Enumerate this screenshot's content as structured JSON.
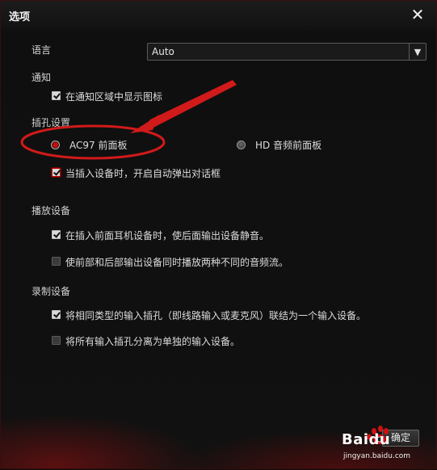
{
  "dialog": {
    "title": "选项"
  },
  "language": {
    "label": "语言",
    "value": "Auto"
  },
  "notification": {
    "label": "通知",
    "show_icon": {
      "label": "在通知区域中显示图标",
      "checked": true
    }
  },
  "jack": {
    "label": "插孔设置",
    "ac97": {
      "label": "AC97 前面板",
      "selected": true
    },
    "hd": {
      "label": "HD 音频前面板",
      "selected": false
    },
    "auto_dialog": {
      "label": "当插入设备时，开启自动弹出对话框",
      "checked": true
    }
  },
  "playback": {
    "label": "播放设备",
    "mute_rear": {
      "label": "在插入前面耳机设备时，使后面输出设备静音。",
      "checked": true
    },
    "two_streams": {
      "label": "使前部和后部输出设备同时播放两种不同的音频流。",
      "checked": false
    }
  },
  "recording": {
    "label": "录制设备",
    "merge_inputs": {
      "label": "将相同类型的输入插孔（即线路输入或麦克风）联结为一个输入设备。",
      "checked": true
    },
    "separate_inputs": {
      "label": "将所有输入插孔分离为单独的输入设备。",
      "checked": false
    }
  },
  "buttons": {
    "ok": "确定"
  },
  "watermark": {
    "brand": "Baidu",
    "site": "jingyan.baidu.com"
  },
  "colors": {
    "accent": "#d11a1a",
    "background": "#111111"
  }
}
